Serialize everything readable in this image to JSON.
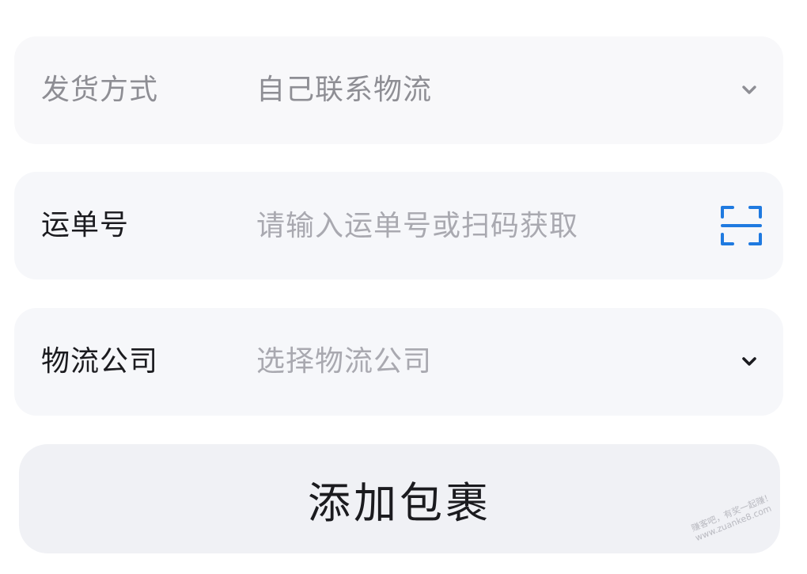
{
  "form": {
    "shipping_method": {
      "label": "发货方式",
      "value": "自己联系物流"
    },
    "waybill": {
      "label": "运单号",
      "placeholder": "请输入运单号或扫码获取"
    },
    "courier": {
      "label": "物流公司",
      "placeholder": "选择物流公司"
    }
  },
  "actions": {
    "add_package": "添加包裹"
  },
  "watermark": {
    "line1": "赚客吧，有奖一起赚！",
    "line2": "www.zuanke8.com"
  },
  "colors": {
    "scan_icon": "#1f7ae0",
    "row_background": "#f6f7fa",
    "button_background": "#f0f1f5"
  },
  "icons": {
    "shipping_method": "chevron-down-icon",
    "waybill": "scan-icon",
    "courier": "chevron-down-icon"
  }
}
